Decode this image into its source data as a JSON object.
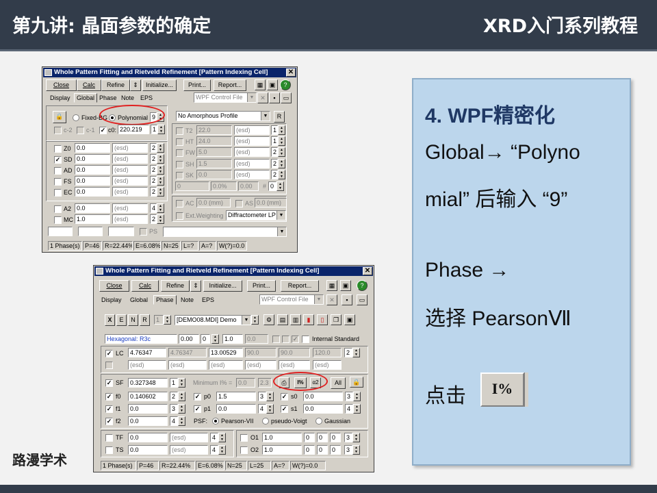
{
  "header": {
    "lecture_title": "第九讲: 晶面参数的确定",
    "series_title": "XRD入门系列教程"
  },
  "brand": "路漫学术",
  "panel": {
    "heading": "4. WPF精密化",
    "lines": [
      "Global→ “Polyno",
      "mial” 后输入 “9”",
      "Phase →",
      "选择 PearsonⅦ",
      "点击"
    ],
    "button_label": "I%"
  },
  "dialog1": {
    "title": "Whole Pattern Fitting and Rietveld Refinement [Pattern Indexing Cell]",
    "toolbar": [
      "Close",
      "Calc",
      "Refine",
      "Initialize...",
      "Print...",
      "Report..."
    ],
    "tabs": [
      "Display",
      "Global",
      "Phase",
      "Note",
      "EPS"
    ],
    "selected_tab": "Global",
    "wpf_control": "WPF Control File",
    "background": {
      "fixed_label": "Fixed-BG",
      "poly_label": "Polynomial",
      "poly_order": "9",
      "c2": "c-2",
      "c1": "c-1",
      "c0": "c0:",
      "c0_value": "220.219",
      "c0_sp": "1"
    },
    "profile": {
      "value": "No Amorphous Profile",
      "btn": "R"
    },
    "params_left": [
      {
        "label": "Z0",
        "value": "0.0",
        "esd": "(esd)",
        "n": "2",
        "checked": false
      },
      {
        "label": "SD",
        "value": "0.0",
        "esd": "(esd)",
        "n": "2",
        "checked": true
      },
      {
        "label": "AD",
        "value": "0.0",
        "esd": "(esd)",
        "n": "2",
        "checked": false
      },
      {
        "label": "FS",
        "value": "0.0",
        "esd": "(esd)",
        "n": "2",
        "checked": false
      },
      {
        "label": "EC",
        "value": "0.0",
        "esd": "(esd)",
        "n": "2",
        "checked": false
      },
      {
        "label": "A2",
        "value": "0.0",
        "esd": "(esd)",
        "n": "4",
        "checked": false
      },
      {
        "label": "MC",
        "value": "1.0",
        "esd": "(esd)",
        "n": "2",
        "checked": false
      }
    ],
    "params_right": [
      {
        "label": "T2",
        "value": "22.0",
        "esd": "(esd)",
        "n": "1"
      },
      {
        "label": "HT",
        "value": "24.0",
        "esd": "(esd)",
        "n": "1"
      },
      {
        "label": "FW",
        "value": "5.0",
        "esd": "(esd)",
        "n": "2"
      },
      {
        "label": "SH",
        "value": "1.5",
        "esd": "(esd)",
        "n": "2"
      },
      {
        "label": "SK",
        "value": "0.0",
        "esd": "(esd)",
        "n": "2"
      }
    ],
    "misc_row": {
      "v1": "0",
      "v2": "0.0%",
      "v3": "0.00",
      "hash": "#",
      "v4": "0"
    },
    "ac": "AC",
    "ac_val": "0.0 (mm)",
    "as": "AS",
    "as_val": "0.0 (mm)",
    "ext_weighting": "Ext.Weighting",
    "diffractometer": "Diffractometer LP",
    "ps": "PS",
    "status": [
      "1 Phase(s)",
      "P=46",
      "R=22.44%",
      "E=6.08%",
      "N=25",
      "L=?",
      "A=?",
      "W(?)=0.0"
    ]
  },
  "dialog2": {
    "title": "Whole Pattern Fitting and Rietveld Refinement [Pattern Indexing Cell]",
    "toolbar": [
      "Close",
      "Calc",
      "Refine",
      "Initialize...",
      "Print...",
      "Report..."
    ],
    "tabs": [
      "Display",
      "Global",
      "Phase",
      "Note",
      "EPS"
    ],
    "selected_tab": "Phase",
    "wpf_control": "WPF Control File",
    "phase_file": "[DEMO08.MDI] Demo",
    "xenr": [
      "X",
      "E",
      "N",
      "R"
    ],
    "phase_num": "1",
    "space_group": "Hexagonal: R3c",
    "sg_fields": [
      "0.00",
      "0",
      "1.0",
      "0.0"
    ],
    "internal_std": "Internal Standard",
    "lc": {
      "label": "LC",
      "values": [
        "4.76347",
        "4.76347",
        "13.00529",
        "90.0",
        "90.0",
        "120.0"
      ],
      "n": "2"
    },
    "sf_row": {
      "label": "SF",
      "value": "0.327348",
      "n": "1",
      "minimum": "Minimum I% =",
      "min_val": "0.0",
      "v2": "2.3",
      "all": "All"
    },
    "peaks": [
      {
        "label": "f0",
        "value": "0.140602",
        "n": "2",
        "plabel": "p0",
        "pvalue": "1.5",
        "pn": "3",
        "slabel": "s0",
        "svalue": "0.0",
        "sn": "3"
      },
      {
        "label": "f1",
        "value": "0.0",
        "n": "3",
        "plabel": "p1",
        "pvalue": "0.0",
        "pn": "4",
        "slabel": "s1",
        "svalue": "0.0",
        "sn": "4"
      },
      {
        "label": "f2",
        "value": "0.0",
        "n": "4"
      }
    ],
    "psf": {
      "label": "PSF:",
      "options": [
        "Pearson-VII",
        "pseudo-Voigt",
        "Gaussian"
      ],
      "selected": "Pearson-VII"
    },
    "tf": {
      "label": "TF",
      "value": "0.0",
      "esd": "(esd)",
      "n": "4"
    },
    "ts": {
      "label": "TS",
      "value": "0.0",
      "esd": "(esd)",
      "n": "4"
    },
    "o1": {
      "label": "O1",
      "values": [
        "1.0",
        "0",
        "0",
        "0"
      ],
      "n": "3"
    },
    "o2": {
      "label": "O2",
      "values": [
        "1.0",
        "0",
        "0",
        "0"
      ],
      "n": "3"
    },
    "esd": "(esd)",
    "status": [
      "1 Phase(s)",
      "P=46",
      "R=22.44%",
      "E=6.08%",
      "N=25",
      "L=25",
      "A=?",
      "W(?)=0.0"
    ]
  },
  "colors": {
    "header_bg": "#323c4a",
    "panel_bg": "#bcd6ec",
    "heading": "#1f3864",
    "highlight": "#e02020",
    "title_bar": "#0a246a"
  }
}
